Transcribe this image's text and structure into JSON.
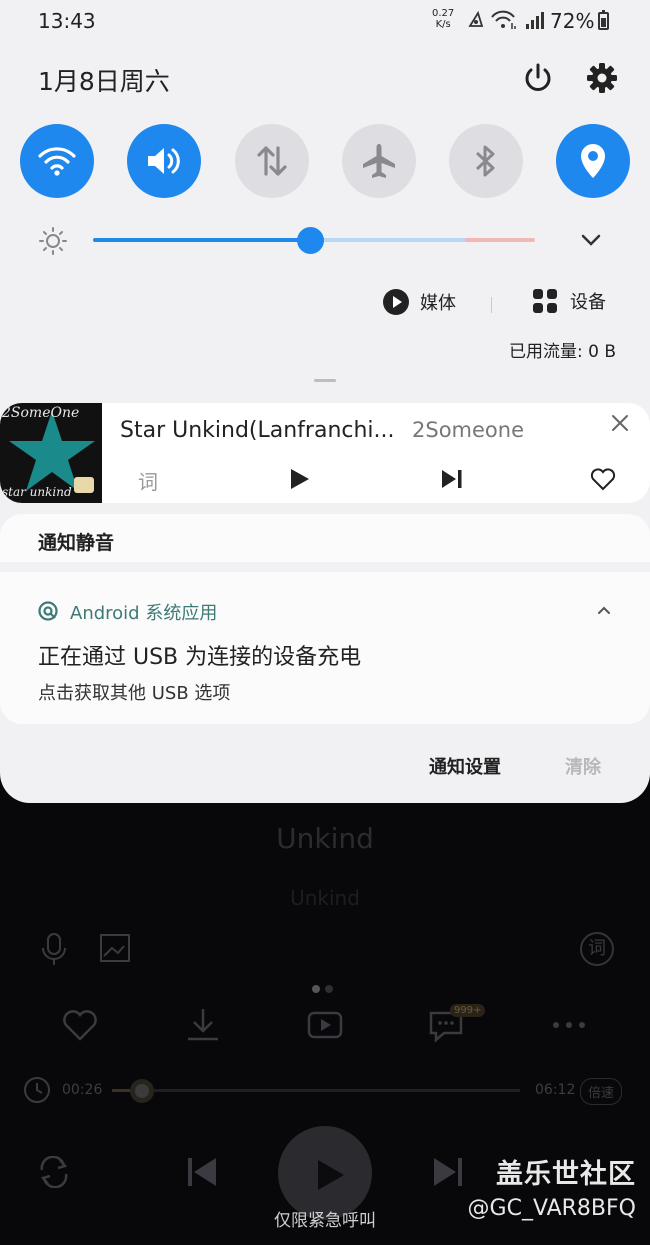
{
  "status_bar": {
    "time": "13:43",
    "net_speed_value": "0.27",
    "net_speed_unit": "K/s",
    "battery": "72%"
  },
  "header": {
    "date": "1月8日周六",
    "power_icon": "power-icon",
    "settings_icon": "gear-icon"
  },
  "quick_settings": [
    {
      "name": "wifi",
      "icon": "wifi-icon",
      "active": true
    },
    {
      "name": "sound",
      "icon": "volume-icon",
      "active": true
    },
    {
      "name": "mobile-data",
      "icon": "data-arrows-icon",
      "active": false
    },
    {
      "name": "airplane",
      "icon": "airplane-icon",
      "active": false
    },
    {
      "name": "bluetooth",
      "icon": "bluetooth-icon",
      "active": false
    },
    {
      "name": "location",
      "icon": "location-pin-icon",
      "active": true
    }
  ],
  "brightness": {
    "level_percent": 49
  },
  "media_output": {
    "media_label": "媒体",
    "devices_label": "设备"
  },
  "data_usage": "已用流量: 0 B",
  "music_notification": {
    "album_text_top": "2SomeOne",
    "album_text_bottom": "star unkind",
    "title": "Star Unkind(Lanfranchi...",
    "artist": "2Someone",
    "lyrics_label": "词"
  },
  "silent_section": {
    "label": "通知静音"
  },
  "system_notification": {
    "app_name": "Android 系统应用",
    "title": "正在通过 USB 为连接的设备充电",
    "subtitle": "点击获取其他 USB 选项"
  },
  "footer": {
    "settings_label": "通知设置",
    "clear_label": "清除"
  },
  "background_player": {
    "song_title": "Unkind",
    "artist": "Unkind",
    "lyrics_label": "词",
    "comment_badge": "999+",
    "elapsed": "00:26",
    "duration": "06:12",
    "speed_label": "倍速"
  },
  "lock_screen": {
    "emergency": "仅限紧急呼叫"
  },
  "watermark": {
    "line1": "盖乐世社区",
    "line2": "@GC_VAR8BFQ"
  },
  "colors": {
    "accent": "#1e88ef",
    "shade_bg": "#f1f1f3",
    "app_name": "#3d7a76"
  }
}
